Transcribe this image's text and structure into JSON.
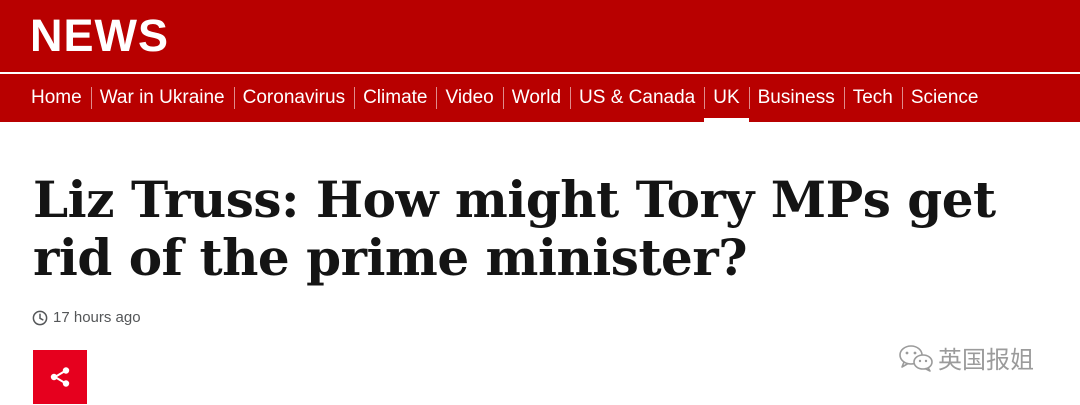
{
  "header": {
    "logo_text": "NEWS",
    "brand_color": "#b80000"
  },
  "nav": {
    "items": [
      {
        "label": "Home",
        "active": false
      },
      {
        "label": "War in Ukraine",
        "active": false
      },
      {
        "label": "Coronavirus",
        "active": false
      },
      {
        "label": "Climate",
        "active": false
      },
      {
        "label": "Video",
        "active": false
      },
      {
        "label": "World",
        "active": false
      },
      {
        "label": "US & Canada",
        "active": false
      },
      {
        "label": "UK",
        "active": true
      },
      {
        "label": "Business",
        "active": false
      },
      {
        "label": "Tech",
        "active": false
      },
      {
        "label": "Science",
        "active": false
      }
    ]
  },
  "article": {
    "headline": "Liz Truss: How might Tory MPs get rid of the prime minister?",
    "timestamp": "17 hours ago",
    "share_icon": "share-icon",
    "share_color": "#e6001e"
  },
  "watermark": {
    "text": "英国报姐",
    "icon": "wechat-icon"
  }
}
